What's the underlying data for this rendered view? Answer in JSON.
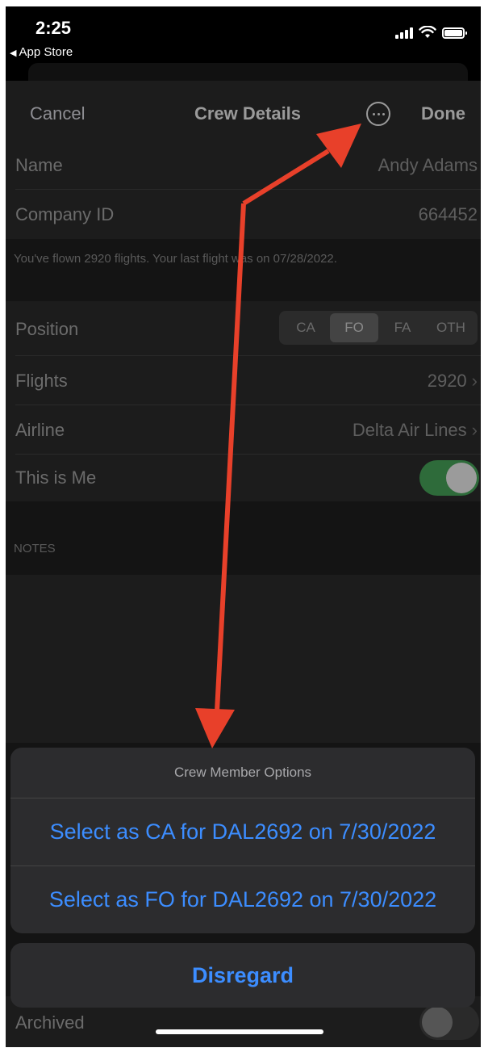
{
  "status_bar": {
    "time": "2:25",
    "back_label": "App Store"
  },
  "nav": {
    "cancel_label": "Cancel",
    "title": "Crew Details",
    "done_label": "Done"
  },
  "crew": {
    "name_label": "Name",
    "name_value": "Andy Adams",
    "company_id_label": "Company ID",
    "company_id_value": "664452",
    "flight_summary": "You've flown 2920 flights. Your last flight was on 07/28/2022.",
    "position_label": "Position",
    "positions": [
      "CA",
      "FO",
      "FA",
      "OTH"
    ],
    "selected_position": "FO",
    "flights_label": "Flights",
    "flights_value": "2920",
    "airline_label": "Airline",
    "airline_value": "Delta Air Lines",
    "this_is_me_label": "This is Me",
    "this_is_me_on": true,
    "notes_header": "NOTES",
    "archived_label": "Archived"
  },
  "action_sheet": {
    "title": "Crew Member Options",
    "options": [
      "Select as CA for DAL2692 on 7/30/2022",
      "Select as FO for DAL2692 on 7/30/2022"
    ],
    "cancel_label": "Disregard"
  },
  "colors": {
    "accent": "#3c8dff",
    "toggle_on": "#2e6b3a",
    "annotation_arrow": "#e8402a"
  }
}
